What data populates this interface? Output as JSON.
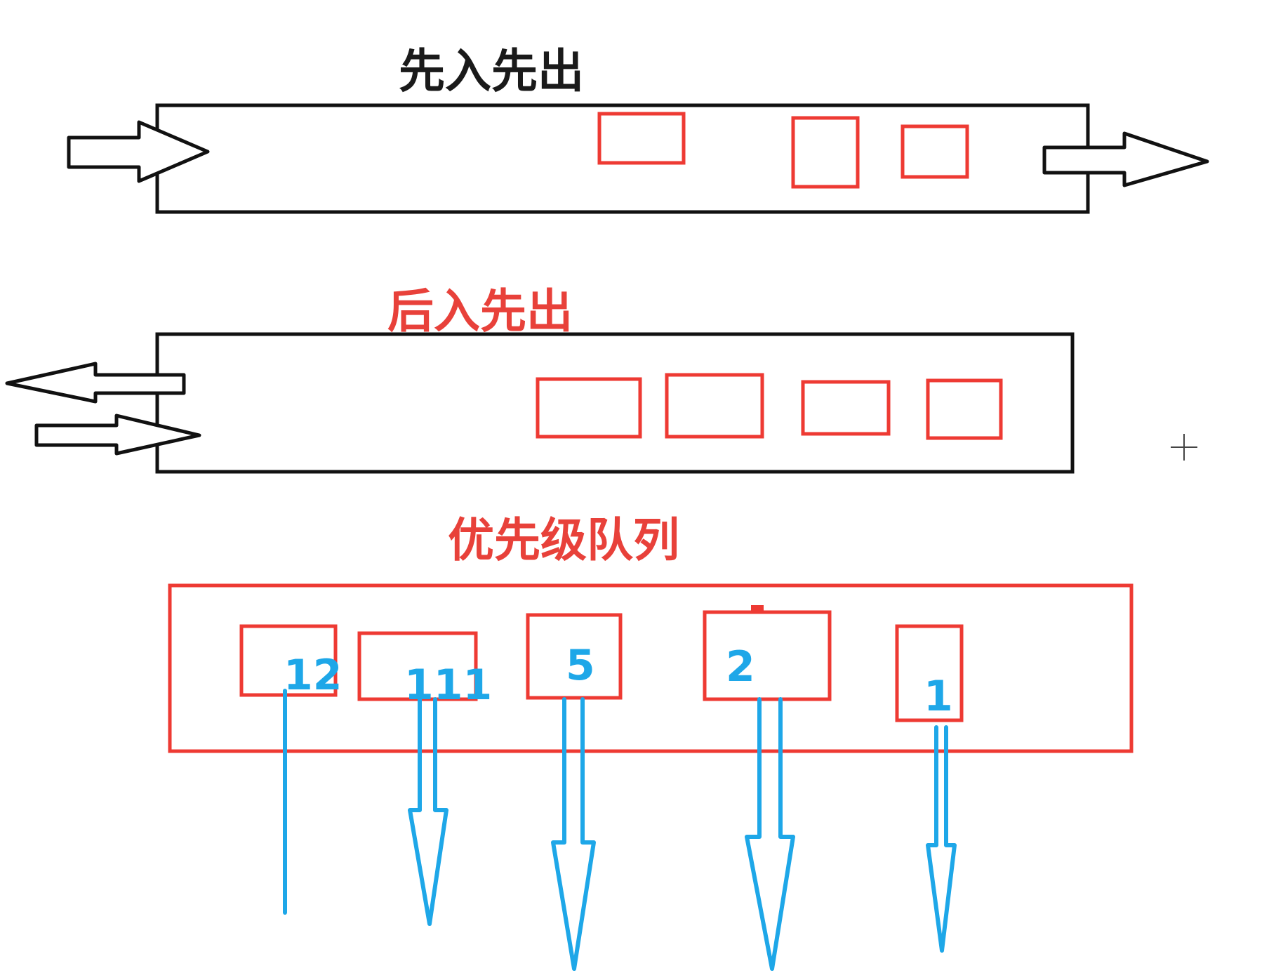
{
  "fifo": {
    "title": "先入先出"
  },
  "lifo": {
    "title": "后入先出"
  },
  "priority": {
    "title": "优先级队列",
    "items": [
      {
        "label": "12"
      },
      {
        "label": "111"
      },
      {
        "label": "5"
      },
      {
        "label": "2"
      },
      {
        "label": "1"
      }
    ]
  },
  "colors": {
    "frame": "#111111",
    "item": "#ee3a33",
    "priority_label": "#1ea7e8",
    "red_title": "#e8413a"
  }
}
